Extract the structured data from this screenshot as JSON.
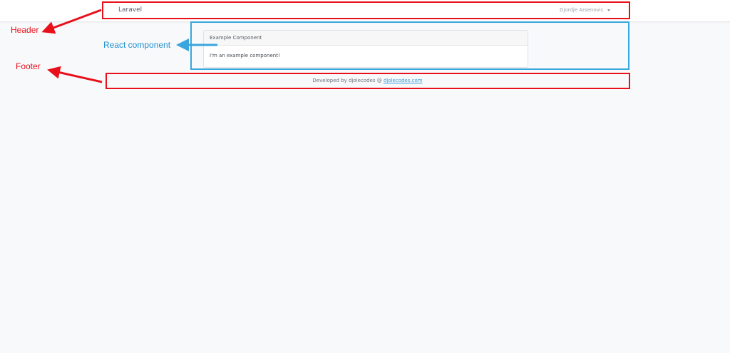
{
  "navbar": {
    "brand": "Laravel",
    "user": "Djordje Arsenovic"
  },
  "card": {
    "header": "Example Component",
    "body": "I'm an example component!"
  },
  "footer": {
    "prefix": "Developed by djolecodes @ ",
    "link_text": "djolecodes.com"
  },
  "annotations": {
    "header_label": "Header",
    "react_label": "React component",
    "footer_label": "Footer",
    "red_color": "#e8101a",
    "blue_color": "#39a6dd"
  }
}
